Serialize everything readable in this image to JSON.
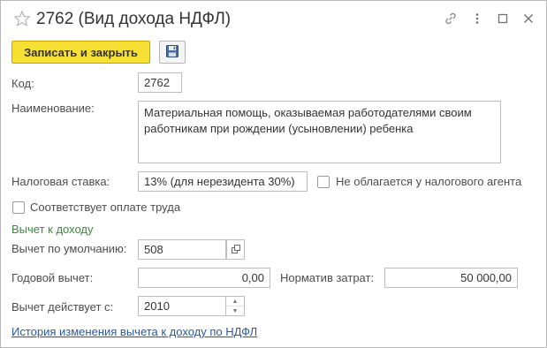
{
  "window": {
    "title": "2762 (Вид дохода НДФЛ)",
    "icons": [
      "star-icon",
      "link-icon",
      "more-icon",
      "maximize-icon",
      "close-icon"
    ]
  },
  "toolbar": {
    "save_close_label": "Записать и закрыть",
    "save_icon": "floppy-disk-icon"
  },
  "form": {
    "code_label": "Код:",
    "code_value": "2762",
    "name_label": "Наименование:",
    "name_value": "Материальная помощь, оказываемая работодателями своим работникам при рождении (усыновлении) ребенка",
    "rate_label": "Налоговая ставка:",
    "rate_value": "13% (для нерезидента 30%)",
    "not_taxed_label": "Не облагается у налогового агента",
    "not_taxed_checked": false,
    "labor_pay_label": "Соответствует оплате труда",
    "labor_pay_checked": false
  },
  "deduction": {
    "section_title": "Вычет к доходу",
    "default_label": "Вычет по умолчанию:",
    "default_value": "508",
    "annual_label": "Годовой вычет:",
    "annual_value": "0,00",
    "norm_label": "Норматив затрат:",
    "norm_value": "50 000,00",
    "valid_from_label": "Вычет действует с:",
    "valid_from_value": "2010",
    "history_link": "История изменения вычета к доходу по НДФЛ"
  },
  "colors": {
    "primary_button": "#f6e034",
    "section_title": "#3a8a3a",
    "link": "#2a5a9b"
  }
}
